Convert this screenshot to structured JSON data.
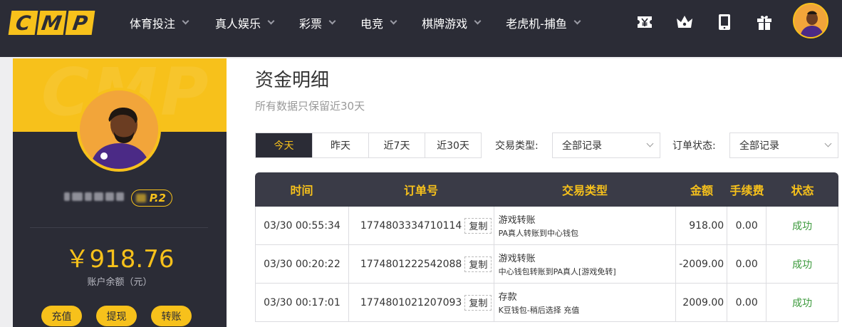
{
  "brand": {
    "letters": [
      "C",
      "M",
      "P"
    ],
    "accent": "#f7c11b",
    "dark": "#2b2c36"
  },
  "nav": [
    {
      "label": "体育投注"
    },
    {
      "label": "真人娱乐"
    },
    {
      "label": "彩票"
    },
    {
      "label": "电竞"
    },
    {
      "label": "棋牌游戏"
    },
    {
      "label": "老虎机-捕鱼"
    }
  ],
  "top_icons": [
    "coupon-yen-icon",
    "crown-icon",
    "mobile-phone-icon",
    "gift-icon"
  ],
  "sidebar": {
    "vip_level": "P.2",
    "balance": "￥918.76",
    "balance_label": "账户余额（元）",
    "buttons": {
      "deposit": "充值",
      "withdraw": "提现",
      "transfer": "转账"
    }
  },
  "main": {
    "title": "资金明细",
    "subtitle": "所有数据只保留近30天",
    "date_tabs": [
      {
        "label": "今天",
        "active": true
      },
      {
        "label": "昨天",
        "active": false
      },
      {
        "label": "近7天",
        "active": false
      },
      {
        "label": "近30天",
        "active": false
      }
    ],
    "filters": {
      "type_label": "交易类型:",
      "type_value": "全部记录",
      "status_label": "订单状态:",
      "status_value": "全部记录"
    }
  },
  "table": {
    "headers": [
      "时间",
      "订单号",
      "交易类型",
      "金额",
      "手续费",
      "状态"
    ],
    "copy_label": "复制",
    "rows": [
      {
        "time": "03/30 00:55:34",
        "order_no": "1774803334710114",
        "type": "游戏转账",
        "detail": "PA真人转账到中心钱包",
        "amount": "918.00",
        "fee": "0.00",
        "status": "成功"
      },
      {
        "time": "03/30 00:20:22",
        "order_no": "1774801222542088",
        "type": "游戏转账",
        "detail": "中心钱包转账到PA真人[游戏免转]",
        "amount": "-2009.00",
        "fee": "0.00",
        "status": "成功"
      },
      {
        "time": "03/30 00:17:01",
        "order_no": "1774801021207093",
        "type": "存款",
        "detail": "K豆钱包-稍后选择 充值",
        "amount": "2009.00",
        "fee": "0.00",
        "status": "成功"
      }
    ]
  }
}
